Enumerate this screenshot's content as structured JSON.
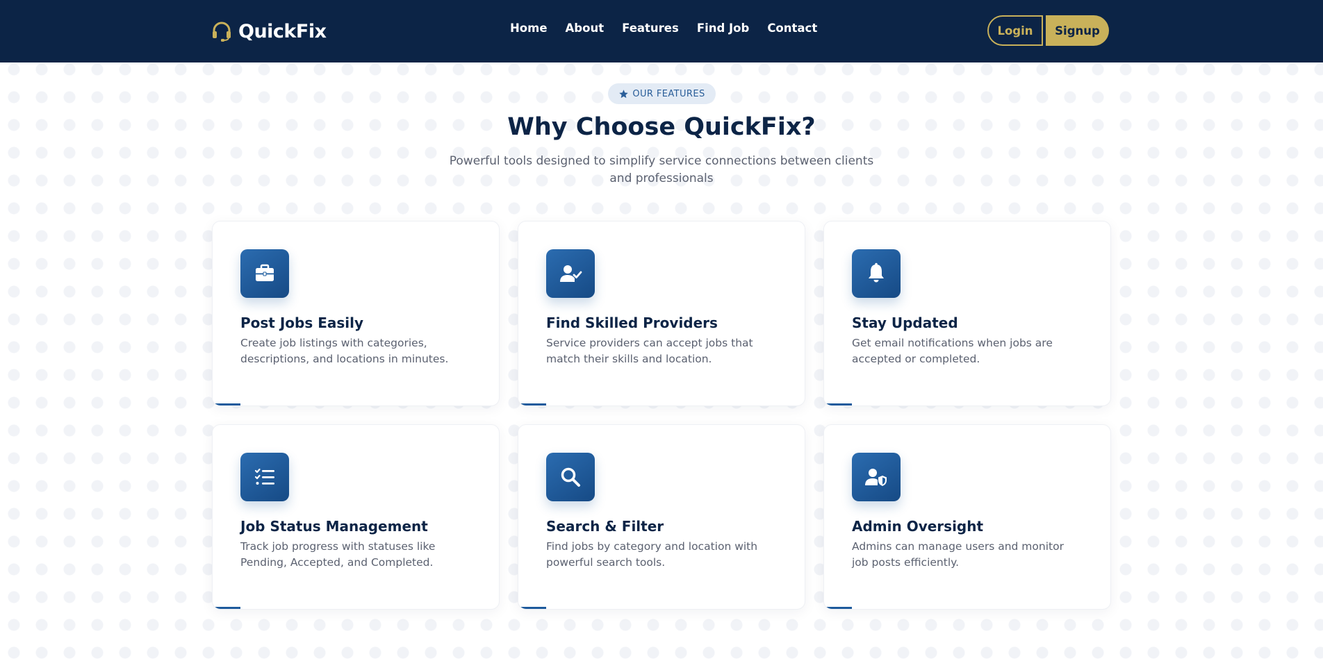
{
  "navbar": {
    "brand": "QuickFix",
    "brand_icon": "headset-icon",
    "links": [
      "Home",
      "About",
      "Features",
      "Find Job",
      "Contact"
    ],
    "login_label": "Login",
    "signup_label": "Signup"
  },
  "features_section": {
    "badge_icon": "star-icon",
    "badge_label": "OUR FEATURES",
    "title": "Why Choose QuickFix?",
    "subtitle": "Powerful tools designed to simplify service connections between clients and professionals",
    "cards": [
      {
        "icon": "briefcase-icon",
        "title": "Post Jobs Easily",
        "description": "Create job listings with categories, descriptions, and locations in minutes."
      },
      {
        "icon": "user-check-icon",
        "title": "Find Skilled Providers",
        "description": "Service providers can accept jobs that match their skills and location."
      },
      {
        "icon": "bell-icon",
        "title": "Stay Updated",
        "description": "Get email notifications when jobs are accepted or completed."
      },
      {
        "icon": "list-check-icon",
        "title": "Job Status Management",
        "description": "Track job progress with statuses like Pending, Accepted, and Completed."
      },
      {
        "icon": "search-icon",
        "title": "Search & Filter",
        "description": "Find jobs by category and location with powerful search tools."
      },
      {
        "icon": "user-shield-icon",
        "title": "Admin Oversight",
        "description": "Admins can manage users and monitor job posts efficiently."
      }
    ]
  },
  "colors": {
    "navbar_bg": "#0c2446",
    "accent_gold": "#c9b15a",
    "primary_blue": "#1d5a9c",
    "badge_bg": "#e3ebf5"
  }
}
